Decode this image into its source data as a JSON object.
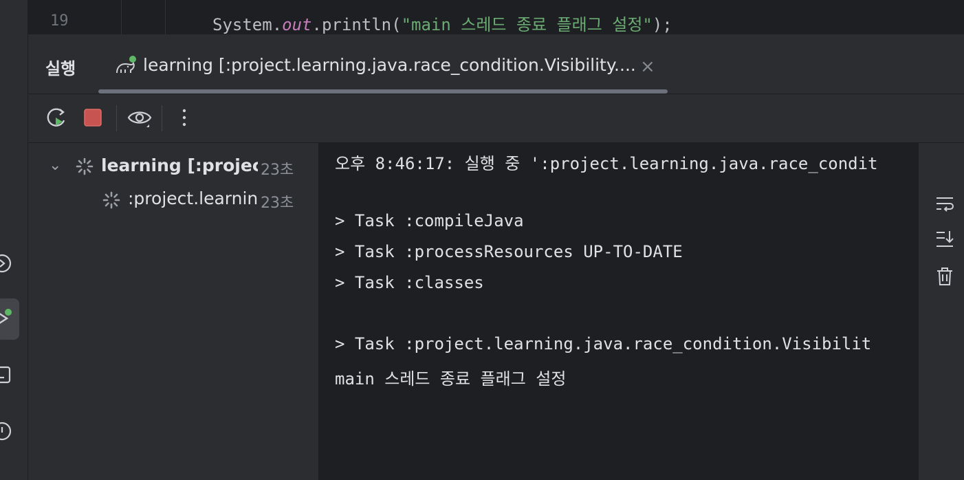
{
  "editor": {
    "line_number": "19",
    "code": {
      "prefix": "System.",
      "field": "out",
      "middle": ".println(",
      "string": "\"main 스레드 종료 플래그 설정\"",
      "suffix": ");"
    }
  },
  "tool_window": {
    "title": "실행",
    "tab": {
      "label": "learning [:project.learning.java.race_condition.Visibility....",
      "close": "×",
      "icon": "gradle-elephant-icon"
    }
  },
  "toolbar": {
    "buttons": [
      {
        "name": "rerun-icon"
      },
      {
        "name": "stop-icon"
      },
      {
        "name": "eye-icon"
      },
      {
        "name": "more-icon"
      }
    ]
  },
  "tree": {
    "root": {
      "label": "learning [:project",
      "time": "23초"
    },
    "child": {
      "label": ":project.learning",
      "time": "23초"
    }
  },
  "console": {
    "lines": [
      "오후 8:46:17: 실행 중 ':project.learning.java.race_condit",
      "",
      "> Task :compileJava",
      "> Task :processResources UP-TO-DATE",
      "> Task :classes",
      "",
      "> Task :project.learning.java.race_condition.Visibilit",
      "main 스레드 종료 플래그 설정"
    ]
  },
  "colors": {
    "accent_green": "#5fb865",
    "stop_red": "#c75450",
    "string_green": "#6aab73",
    "field_purple": "#c77dbb"
  }
}
